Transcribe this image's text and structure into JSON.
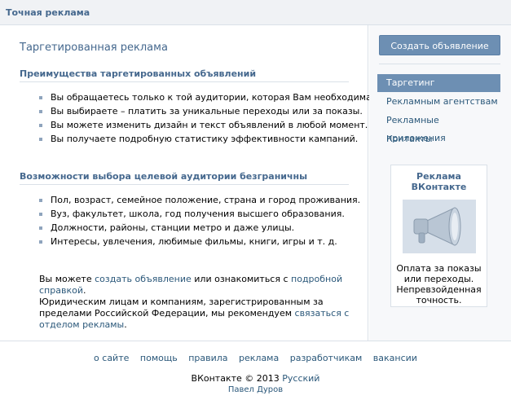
{
  "header": {
    "title": "Точная реклама"
  },
  "main": {
    "heading": "Таргетированная реклама",
    "section1": {
      "title": "Преимущества таргетированных объявлений",
      "items": [
        "Вы обращаетесь только к той аудитории, которая Вам необходима.",
        "Вы выбираете – платить за уникальные переходы или за показы.",
        "Вы можете изменить дизайн и текст объявлений в любой момент.",
        "Вы получаете подробную статистику эффективности кампаний."
      ]
    },
    "section2": {
      "title": "Возможности выбора целевой аудитории безграничны",
      "items": [
        "Пол, возраст, семейное положение, страна и город проживания.",
        "Вуз, факультет, школа, год получения высшего образования.",
        "Должности, районы, станции метро и даже улицы.",
        "Интересы, увлечения, любимые фильмы, книги, игры и т. д."
      ]
    },
    "para1": {
      "prefix": "Вы можете ",
      "link1": "создать объявление",
      "middle": " или ознакомиться с ",
      "link2": "подробной справкой",
      "suffix": "."
    },
    "para2": {
      "text": "Юридическим лицам и компаниям, зарегистрированным за пределами Российской Федерации, мы рекомендуем ",
      "link": "связаться с отделом рекламы",
      "suffix": "."
    }
  },
  "sidebar": {
    "create_button": "Создать объявление",
    "menu": [
      {
        "label": "Таргетинг",
        "active": true
      },
      {
        "label": "Рекламным агентствам",
        "active": false
      },
      {
        "label": "Рекламные приложения",
        "active": false
      },
      {
        "label": "Контакты",
        "active": false
      }
    ],
    "promo": {
      "title": "Реклама ВКонтакте",
      "image_icon": "megaphone-icon",
      "text": "Оплата за показы или переходы. Непревзойденная точность."
    }
  },
  "footer": {
    "links": [
      "о сайте",
      "помощь",
      "правила",
      "реклама",
      "разработчикам",
      "вакансии"
    ],
    "copyright": "ВКонтакте © 2013",
    "language": "Русский",
    "author": "Павел Дуров"
  },
  "colors": {
    "accent": "#45688e",
    "link": "#2b587a",
    "button": "#6d8fb3",
    "border": "#dae1e8"
  }
}
